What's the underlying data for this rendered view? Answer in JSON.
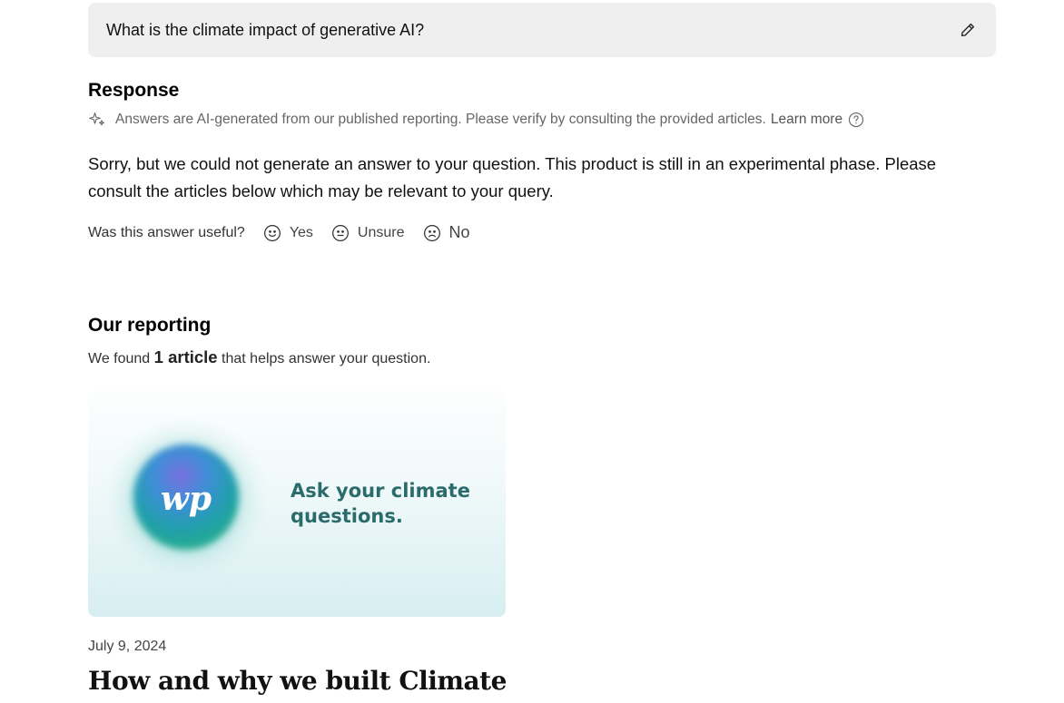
{
  "question": {
    "text": "What is the climate impact of generative AI?",
    "edit_icon": "pencil-icon"
  },
  "response": {
    "heading": "Response",
    "disclaimer": "Answers are AI-generated from our published reporting. Please verify by consulting the provided articles.",
    "learn_more": "Learn more",
    "answer": "Sorry, but we could not generate an answer to your question. This product is still in an experimental phase. Please consult the articles below which may be relevant to your query."
  },
  "feedback": {
    "prompt": "Was this answer useful?",
    "options": [
      {
        "label": "Yes",
        "icon": "smile-icon"
      },
      {
        "label": "Unsure",
        "icon": "neutral-face-icon"
      },
      {
        "label": "No",
        "icon": "frown-icon"
      }
    ]
  },
  "reporting": {
    "heading": "Our reporting",
    "found_prefix": "We found",
    "found_count": "1 article",
    "found_suffix": "that helps answer your question.",
    "articles": [
      {
        "image_caption": "Ask your climate questions.",
        "logo_text": "wp",
        "date": "July 9, 2024",
        "title": "How and why we built Climate"
      }
    ]
  },
  "colors": {
    "question_bg": "#efefef",
    "caption": "#2a6b6b",
    "muted_text": "#666666"
  }
}
